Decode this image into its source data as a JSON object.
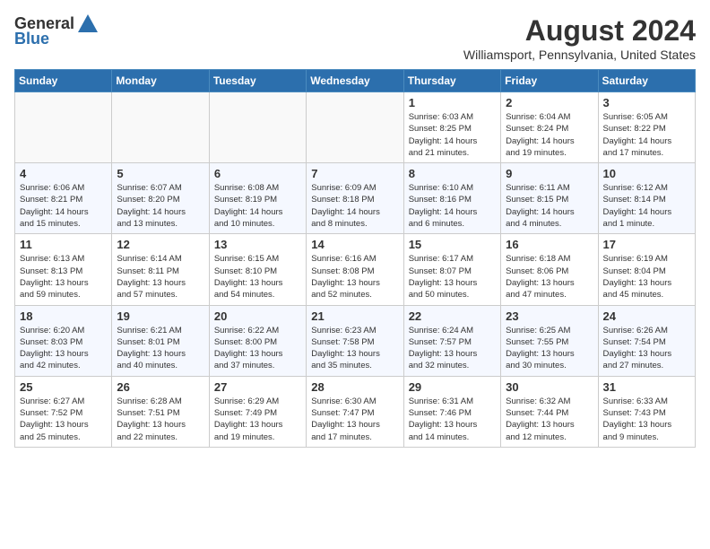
{
  "header": {
    "logo_general": "General",
    "logo_blue": "Blue",
    "month_title": "August 2024",
    "location": "Williamsport, Pennsylvania, United States"
  },
  "calendar": {
    "days_of_week": [
      "Sunday",
      "Monday",
      "Tuesday",
      "Wednesday",
      "Thursday",
      "Friday",
      "Saturday"
    ],
    "weeks": [
      [
        {
          "day": "",
          "info": ""
        },
        {
          "day": "",
          "info": ""
        },
        {
          "day": "",
          "info": ""
        },
        {
          "day": "",
          "info": ""
        },
        {
          "day": "1",
          "info": "Sunrise: 6:03 AM\nSunset: 8:25 PM\nDaylight: 14 hours\nand 21 minutes."
        },
        {
          "day": "2",
          "info": "Sunrise: 6:04 AM\nSunset: 8:24 PM\nDaylight: 14 hours\nand 19 minutes."
        },
        {
          "day": "3",
          "info": "Sunrise: 6:05 AM\nSunset: 8:22 PM\nDaylight: 14 hours\nand 17 minutes."
        }
      ],
      [
        {
          "day": "4",
          "info": "Sunrise: 6:06 AM\nSunset: 8:21 PM\nDaylight: 14 hours\nand 15 minutes."
        },
        {
          "day": "5",
          "info": "Sunrise: 6:07 AM\nSunset: 8:20 PM\nDaylight: 14 hours\nand 13 minutes."
        },
        {
          "day": "6",
          "info": "Sunrise: 6:08 AM\nSunset: 8:19 PM\nDaylight: 14 hours\nand 10 minutes."
        },
        {
          "day": "7",
          "info": "Sunrise: 6:09 AM\nSunset: 8:18 PM\nDaylight: 14 hours\nand 8 minutes."
        },
        {
          "day": "8",
          "info": "Sunrise: 6:10 AM\nSunset: 8:16 PM\nDaylight: 14 hours\nand 6 minutes."
        },
        {
          "day": "9",
          "info": "Sunrise: 6:11 AM\nSunset: 8:15 PM\nDaylight: 14 hours\nand 4 minutes."
        },
        {
          "day": "10",
          "info": "Sunrise: 6:12 AM\nSunset: 8:14 PM\nDaylight: 14 hours\nand 1 minute."
        }
      ],
      [
        {
          "day": "11",
          "info": "Sunrise: 6:13 AM\nSunset: 8:13 PM\nDaylight: 13 hours\nand 59 minutes."
        },
        {
          "day": "12",
          "info": "Sunrise: 6:14 AM\nSunset: 8:11 PM\nDaylight: 13 hours\nand 57 minutes."
        },
        {
          "day": "13",
          "info": "Sunrise: 6:15 AM\nSunset: 8:10 PM\nDaylight: 13 hours\nand 54 minutes."
        },
        {
          "day": "14",
          "info": "Sunrise: 6:16 AM\nSunset: 8:08 PM\nDaylight: 13 hours\nand 52 minutes."
        },
        {
          "day": "15",
          "info": "Sunrise: 6:17 AM\nSunset: 8:07 PM\nDaylight: 13 hours\nand 50 minutes."
        },
        {
          "day": "16",
          "info": "Sunrise: 6:18 AM\nSunset: 8:06 PM\nDaylight: 13 hours\nand 47 minutes."
        },
        {
          "day": "17",
          "info": "Sunrise: 6:19 AM\nSunset: 8:04 PM\nDaylight: 13 hours\nand 45 minutes."
        }
      ],
      [
        {
          "day": "18",
          "info": "Sunrise: 6:20 AM\nSunset: 8:03 PM\nDaylight: 13 hours\nand 42 minutes."
        },
        {
          "day": "19",
          "info": "Sunrise: 6:21 AM\nSunset: 8:01 PM\nDaylight: 13 hours\nand 40 minutes."
        },
        {
          "day": "20",
          "info": "Sunrise: 6:22 AM\nSunset: 8:00 PM\nDaylight: 13 hours\nand 37 minutes."
        },
        {
          "day": "21",
          "info": "Sunrise: 6:23 AM\nSunset: 7:58 PM\nDaylight: 13 hours\nand 35 minutes."
        },
        {
          "day": "22",
          "info": "Sunrise: 6:24 AM\nSunset: 7:57 PM\nDaylight: 13 hours\nand 32 minutes."
        },
        {
          "day": "23",
          "info": "Sunrise: 6:25 AM\nSunset: 7:55 PM\nDaylight: 13 hours\nand 30 minutes."
        },
        {
          "day": "24",
          "info": "Sunrise: 6:26 AM\nSunset: 7:54 PM\nDaylight: 13 hours\nand 27 minutes."
        }
      ],
      [
        {
          "day": "25",
          "info": "Sunrise: 6:27 AM\nSunset: 7:52 PM\nDaylight: 13 hours\nand 25 minutes."
        },
        {
          "day": "26",
          "info": "Sunrise: 6:28 AM\nSunset: 7:51 PM\nDaylight: 13 hours\nand 22 minutes."
        },
        {
          "day": "27",
          "info": "Sunrise: 6:29 AM\nSunset: 7:49 PM\nDaylight: 13 hours\nand 19 minutes."
        },
        {
          "day": "28",
          "info": "Sunrise: 6:30 AM\nSunset: 7:47 PM\nDaylight: 13 hours\nand 17 minutes."
        },
        {
          "day": "29",
          "info": "Sunrise: 6:31 AM\nSunset: 7:46 PM\nDaylight: 13 hours\nand 14 minutes."
        },
        {
          "day": "30",
          "info": "Sunrise: 6:32 AM\nSunset: 7:44 PM\nDaylight: 13 hours\nand 12 minutes."
        },
        {
          "day": "31",
          "info": "Sunrise: 6:33 AM\nSunset: 7:43 PM\nDaylight: 13 hours\nand 9 minutes."
        }
      ]
    ]
  }
}
